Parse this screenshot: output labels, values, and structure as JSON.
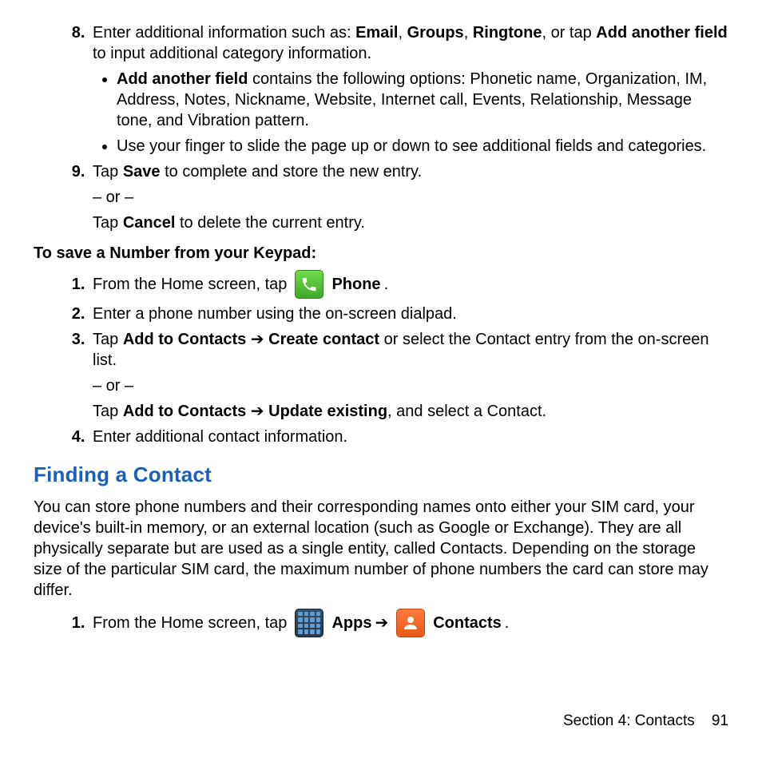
{
  "step8": {
    "prefix": "Enter additional information such as: ",
    "b1": "Email",
    "sep1": ", ",
    "b2": "Groups",
    "sep2": ", ",
    "b3": "Ringtone",
    "sep3": ", or tap ",
    "b4": "Add another field",
    "suffix": " to input additional category information.",
    "sub1_b": "Add another field",
    "sub1_rest": " contains the following options: Phonetic name, Organization, IM, Address, Notes, Nickname, Website, Internet call, Events, Relationship, Message tone, and Vibration pattern.",
    "sub2": "Use your finger to slide the page up or down to see additional fields and categories."
  },
  "step9": {
    "prefix": "Tap ",
    "b1": "Save",
    "mid": " to complete and store the new entry.",
    "or": "– or –",
    "prefix2": "Tap ",
    "b2": "Cancel",
    "suffix": " to delete the current entry."
  },
  "subhead": "To save a Number from your Keypad:",
  "k1": {
    "prefix": "From the Home screen, tap ",
    "b": "Phone",
    "dot": "."
  },
  "k2": "Enter a phone number using the on-screen dialpad.",
  "k3": {
    "prefix": "Tap ",
    "b1": "Add to Contacts",
    "arrow": " ➔ ",
    "b2": "Create contact",
    "mid": " or select the Contact entry from the on-screen list.",
    "or": "– or –",
    "prefix2": "Tap ",
    "b3": "Add to Contacts",
    "arrow2": " ➔ ",
    "b4": "Update existing",
    "suffix": ", and select a Contact."
  },
  "k4": "Enter additional contact information.",
  "heading": "Finding a Contact",
  "para": "You can store phone numbers and their corresponding names onto either your SIM card, your device's built-in memory, or an external location (such as Google or Exchange). They are all physically separate but are used as a single entity, called Contacts. Depending on the storage size of the particular SIM card, the maximum number of phone numbers the card can store may differ.",
  "f1": {
    "prefix": "From the Home screen, tap ",
    "b1": "Apps",
    "arrow": " ➔ ",
    "b2": "Contacts",
    "dot": "."
  },
  "footer": {
    "section": "Section 4:  Contacts",
    "page": "91"
  }
}
